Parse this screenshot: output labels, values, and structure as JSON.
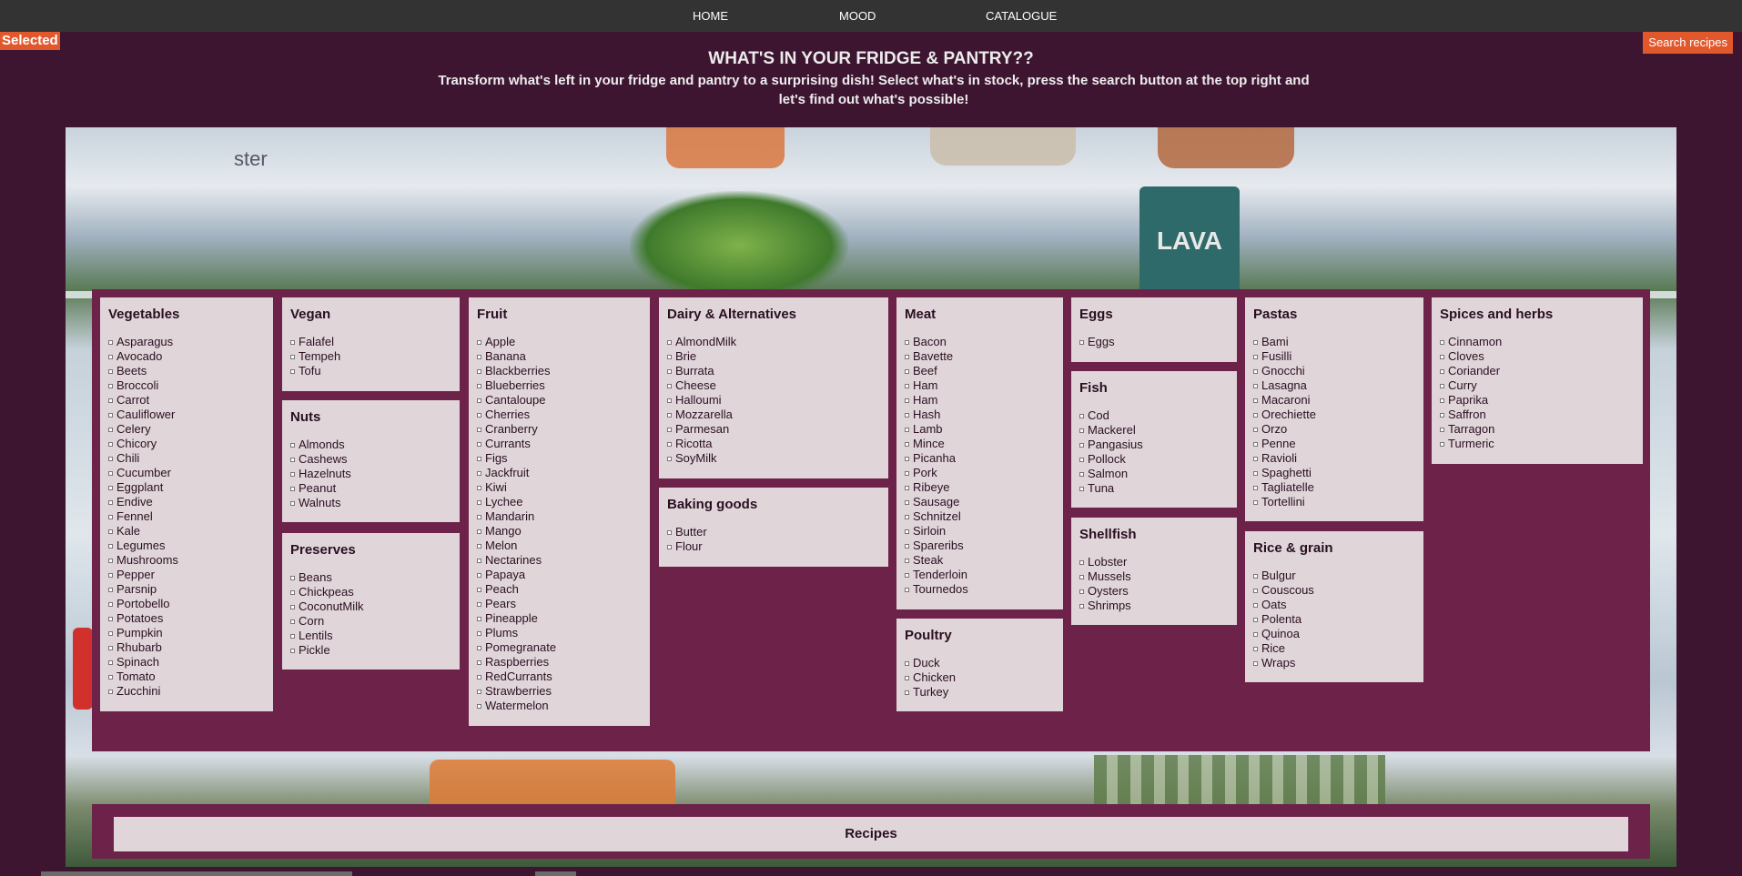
{
  "nav": {
    "home": "HOME",
    "mood": "MOOD",
    "catalogue": "CATALOGUE"
  },
  "selected_label": "Selected",
  "search_button": "Search recipes",
  "heading": "WHAT'S IN YOUR FRIDGE & PANTRY??",
  "subheading": "Transform what's left in your fridge and pantry to a surprising dish! Select what's in stock, press the search button at the top right and let's find out what's possible!",
  "photo_text": {
    "ster": "ster",
    "lava": "LAVA"
  },
  "categories": {
    "vegetables": {
      "title": "Vegetables",
      "items": [
        "Asparagus",
        "Avocado",
        "Beets",
        "Broccoli",
        "Carrot",
        "Cauliflower",
        "Celery",
        "Chicory",
        "Chili",
        "Cucumber",
        "Eggplant",
        "Endive",
        "Fennel",
        "Kale",
        "Legumes",
        "Mushrooms",
        "Pepper",
        "Parsnip",
        "Portobello",
        "Potatoes",
        "Pumpkin",
        "Rhubarb",
        "Spinach",
        "Tomato",
        "Zucchini"
      ]
    },
    "vegan": {
      "title": "Vegan",
      "items": [
        "Falafel",
        "Tempeh",
        "Tofu"
      ]
    },
    "nuts": {
      "title": "Nuts",
      "items": [
        "Almonds",
        "Cashews",
        "Hazelnuts",
        "Peanut",
        "Walnuts"
      ]
    },
    "preserves": {
      "title": "Preserves",
      "items": [
        "Beans",
        "Chickpeas",
        "CoconutMilk",
        "Corn",
        "Lentils",
        "Pickle"
      ]
    },
    "fruit": {
      "title": "Fruit",
      "items": [
        "Apple",
        "Banana",
        "Blackberries",
        "Blueberries",
        "Cantaloupe",
        "Cherries",
        "Cranberry",
        "Currants",
        "Figs",
        "Jackfruit",
        "Kiwi",
        "Lychee",
        "Mandarin",
        "Mango",
        "Melon",
        "Nectarines",
        "Papaya",
        "Peach",
        "Pears",
        "Pineapple",
        "Plums",
        "Pomegranate",
        "Raspberries",
        "RedCurrants",
        "Strawberries",
        "Watermelon"
      ]
    },
    "dairy": {
      "title": "Dairy & Alternatives",
      "items": [
        "AlmondMilk",
        "Brie",
        "Burrata",
        "Cheese",
        "Halloumi",
        "Mozzarella",
        "Parmesan",
        "Ricotta",
        "SoyMilk"
      ]
    },
    "baking": {
      "title": "Baking goods",
      "items": [
        "Butter",
        "Flour"
      ]
    },
    "meat": {
      "title": "Meat",
      "items": [
        "Bacon",
        "Bavette",
        "Beef",
        "Ham",
        "Ham",
        "Hash",
        "Lamb",
        "Mince",
        "Picanha",
        "Pork",
        "Ribeye",
        "Sausage",
        "Schnitzel",
        "Sirloin",
        "Spareribs",
        "Steak",
        "Tenderloin",
        "Tournedos"
      ]
    },
    "poultry": {
      "title": "Poultry",
      "items": [
        "Duck",
        "Chicken",
        "Turkey"
      ]
    },
    "eggs": {
      "title": "Eggs",
      "items": [
        "Eggs"
      ]
    },
    "fish": {
      "title": "Fish",
      "items": [
        "Cod",
        "Mackerel",
        "Pangasius",
        "Pollock",
        "Salmon",
        "Tuna"
      ]
    },
    "shellfish": {
      "title": "Shellfish",
      "items": [
        "Lobster",
        "Mussels",
        "Oysters",
        "Shrimps"
      ]
    },
    "pastas": {
      "title": "Pastas",
      "items": [
        "Bami",
        "Fusilli",
        "Gnocchi",
        "Lasagna",
        "Macaroni",
        "Orechiette",
        "Orzo",
        "Penne",
        "Ravioli",
        "Spaghetti",
        "Tagliatelle",
        "Tortellini"
      ]
    },
    "rice": {
      "title": "Rice & grain",
      "items": [
        "Bulgur",
        "Couscous",
        "Oats",
        "Polenta",
        "Quinoa",
        "Rice",
        "Wraps"
      ]
    },
    "spices": {
      "title": "Spices and herbs",
      "items": [
        "Cinnamon",
        "Cloves",
        "Coriander",
        "Curry",
        "Paprika",
        "Saffron",
        "Tarragon",
        "Turmeric"
      ]
    }
  },
  "recipes_label": "Recipes"
}
